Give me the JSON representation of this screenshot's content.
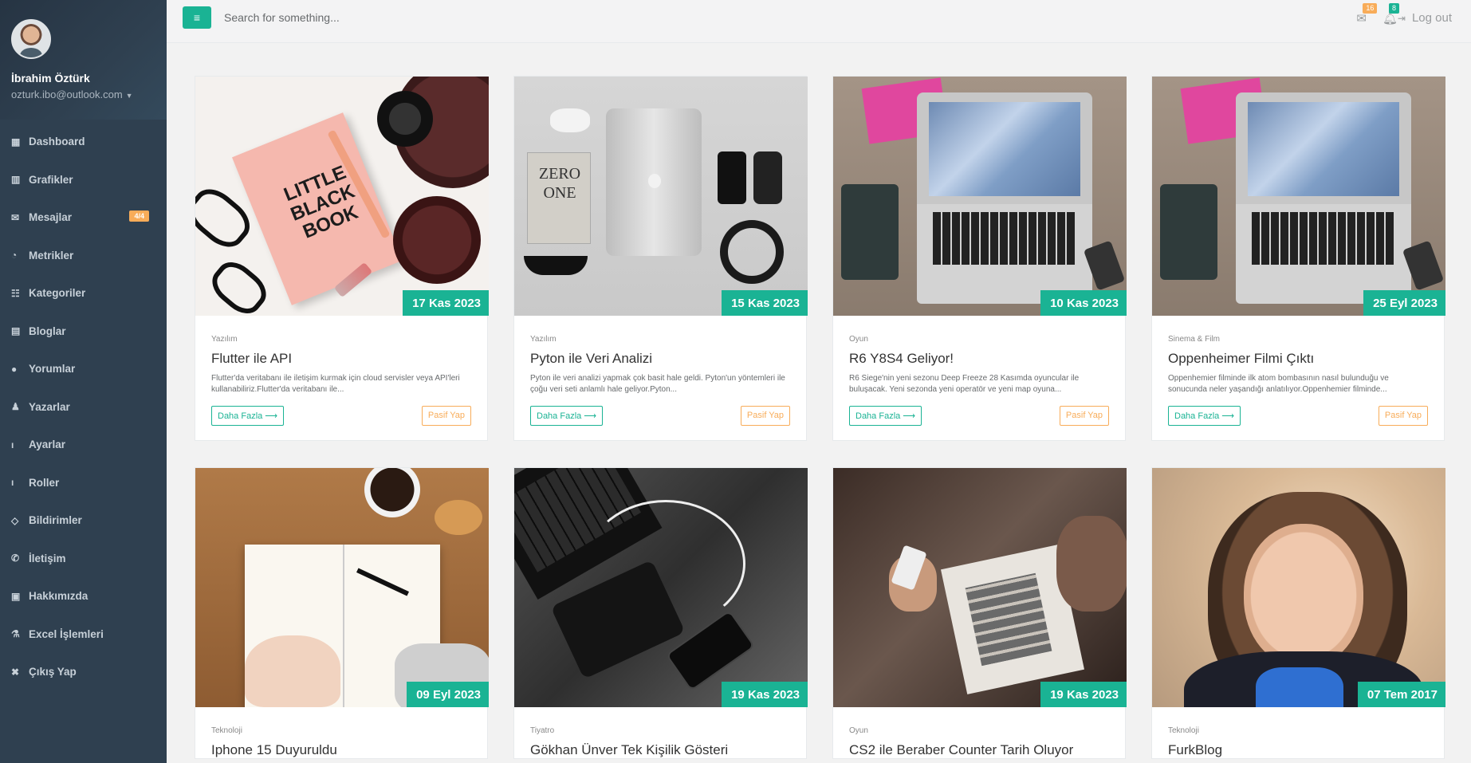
{
  "user": {
    "name": "İbrahim Öztürk",
    "email": "ozturk.ibo@outlook.com"
  },
  "sidebar": {
    "items": [
      {
        "label": "Dashboard",
        "icon": "dashboard-icon",
        "glyph": "▦"
      },
      {
        "label": "Grafikler",
        "icon": "bar-chart-icon",
        "glyph": "▥"
      },
      {
        "label": "Mesajlar",
        "icon": "envelope-icon",
        "glyph": "✉",
        "badge": "4/4"
      },
      {
        "label": "Metrikler",
        "icon": "pie-chart-icon",
        "glyph": "◔"
      },
      {
        "label": "Kategoriler",
        "icon": "users-icon",
        "glyph": "☷"
      },
      {
        "label": "Bloglar",
        "icon": "list-icon",
        "glyph": "▤"
      },
      {
        "label": "Yorumlar",
        "icon": "comment-icon",
        "glyph": "●"
      },
      {
        "label": "Yazarlar",
        "icon": "user-icon",
        "glyph": "♟"
      },
      {
        "label": "Ayarlar",
        "icon": "info-icon",
        "glyph": "ı"
      },
      {
        "label": "Roller",
        "icon": "info-icon",
        "glyph": "ı"
      },
      {
        "label": "Bildirimler",
        "icon": "diamond-icon",
        "glyph": "◇"
      },
      {
        "label": "İletişim",
        "icon": "phone-icon",
        "glyph": "✆"
      },
      {
        "label": "Hakkımızda",
        "icon": "contact-card-icon",
        "glyph": "▣"
      },
      {
        "label": "Excel İşlemleri",
        "icon": "flask-icon",
        "glyph": "⚗"
      },
      {
        "label": "Çıkış Yap",
        "icon": "close-icon",
        "glyph": "✖"
      }
    ]
  },
  "topbar": {
    "menu_glyph": "≡",
    "search_placeholder": "Search for something...",
    "mail_count": "16",
    "bell_count": "8",
    "logout_label": "Log out"
  },
  "cards": [
    {
      "category": "Yazılım",
      "title": "Flutter ile API",
      "desc": "Flutter'da veritabanı ile iletişim kurmak için cloud servisler veya API'leri kullanabiliriz.Flutter'da veritabanı ile...",
      "date": "17 Kas 2023",
      "more": "Daha Fazla ⟶",
      "passive": "Pasif Yap",
      "art": "book"
    },
    {
      "category": "Yazılım",
      "title": "Pyton ile Veri Analizi",
      "desc": "Pyton ile veri analizi yapmak çok basit hale geldi. Pyton'un yöntemleri ile çoğu veri seti anlamlı hale geliyor.Pyton...",
      "date": "15 Kas 2023",
      "more": "Daha Fazla ⟶",
      "passive": "Pasif Yap",
      "art": "flat"
    },
    {
      "category": "Oyun",
      "title": "R6 Y8S4 Geliyor!",
      "desc": "R6 Siege'nin yeni sezonu Deep Freeze 28 Kasımda oyuncular ile buluşacak. Yeni sezonda yeni operatör ve yeni map oyuna...",
      "date": "10 Kas 2023",
      "more": "Daha Fazla ⟶",
      "passive": "Pasif Yap",
      "art": "desk"
    },
    {
      "category": "Sinema & Film",
      "title": "Oppenheimer Filmi Çıktı",
      "desc": "Oppenhemier filminde ilk atom bombasının nasıl bulunduğu ve sonucunda neler yaşandığı anlatılıyor.Oppenhemier filminde...",
      "date": "25 Eyl 2023",
      "more": "Daha Fazla ⟶",
      "passive": "Pasif Yap",
      "art": "desk"
    },
    {
      "category": "Teknoloji",
      "title": "Iphone 15 Duyuruldu",
      "date": "09 Eyl 2023",
      "art": "note"
    },
    {
      "category": "Tiyatro",
      "title": "Gökhan Ünver Tek Kişilik Gösteri",
      "date": "19 Kas 2023",
      "art": "bw"
    },
    {
      "category": "Oyun",
      "title": "CS2 ile Beraber Counter Tarih Oluyor",
      "date": "19 Kas 2023",
      "art": "cafe"
    },
    {
      "category": "Teknoloji",
      "title": "FurkBlog",
      "date": "07 Tem 2017",
      "art": "port"
    }
  ],
  "colors": {
    "sidebar": "#2f4050",
    "accent": "#1ab394",
    "warning": "#f8ac59"
  }
}
